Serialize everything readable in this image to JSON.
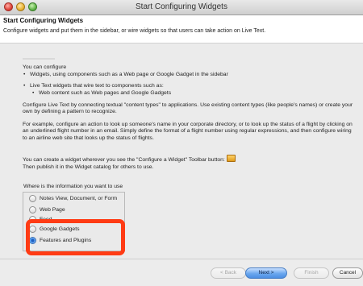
{
  "window": {
    "title": "Start Configuring Widgets"
  },
  "header": {
    "title": "Start Configuring Widgets",
    "description": "Configure widgets and put them in the sidebar, or wire widgets so that users can take action on Live Text."
  },
  "content": {
    "intro": "You can configure",
    "bullet1": "Widgets, using components such as a Web page or Google Gadget in the sidebar",
    "bullet2": "Live Text widgets that wire text to components such as:",
    "bullet2_sub": "Web content such as Web pages and Google Gadgets",
    "para1": "Configure Live Text by connecting textual \"content types\" to applications. Use existing content types (like people's names) or create your own by defining a pattern to recognize.",
    "para2": "For example, configure an action to look up someone's name in your corporate directory, or to look up the status of a flight by clicking on an underlined flight number in an email. Simply define the format of a flight number using regular expressions, and then configure wiring to an airline web site that looks up the status of flights.",
    "para3": "You can create a widget wherever you see the \"Configure a Widget\" Toolbar button:",
    "para4": "Then publish it in the Widget catalog for others to use.",
    "question": "Where is the information you want to use",
    "options": [
      {
        "label": "Notes View, Document, or Form",
        "selected": false
      },
      {
        "label": "Web Page",
        "selected": false
      },
      {
        "label": "Feed",
        "selected": false
      },
      {
        "label": "Google Gadgets",
        "selected": false
      },
      {
        "label": "Features and Plugins",
        "selected": true
      }
    ]
  },
  "buttons": {
    "back": "< Back",
    "next": "Next >",
    "finish": "Finish",
    "cancel": "Cancel"
  },
  "colors": {
    "highlight": "#ff3b14",
    "default_button": "#4b8ee2"
  }
}
